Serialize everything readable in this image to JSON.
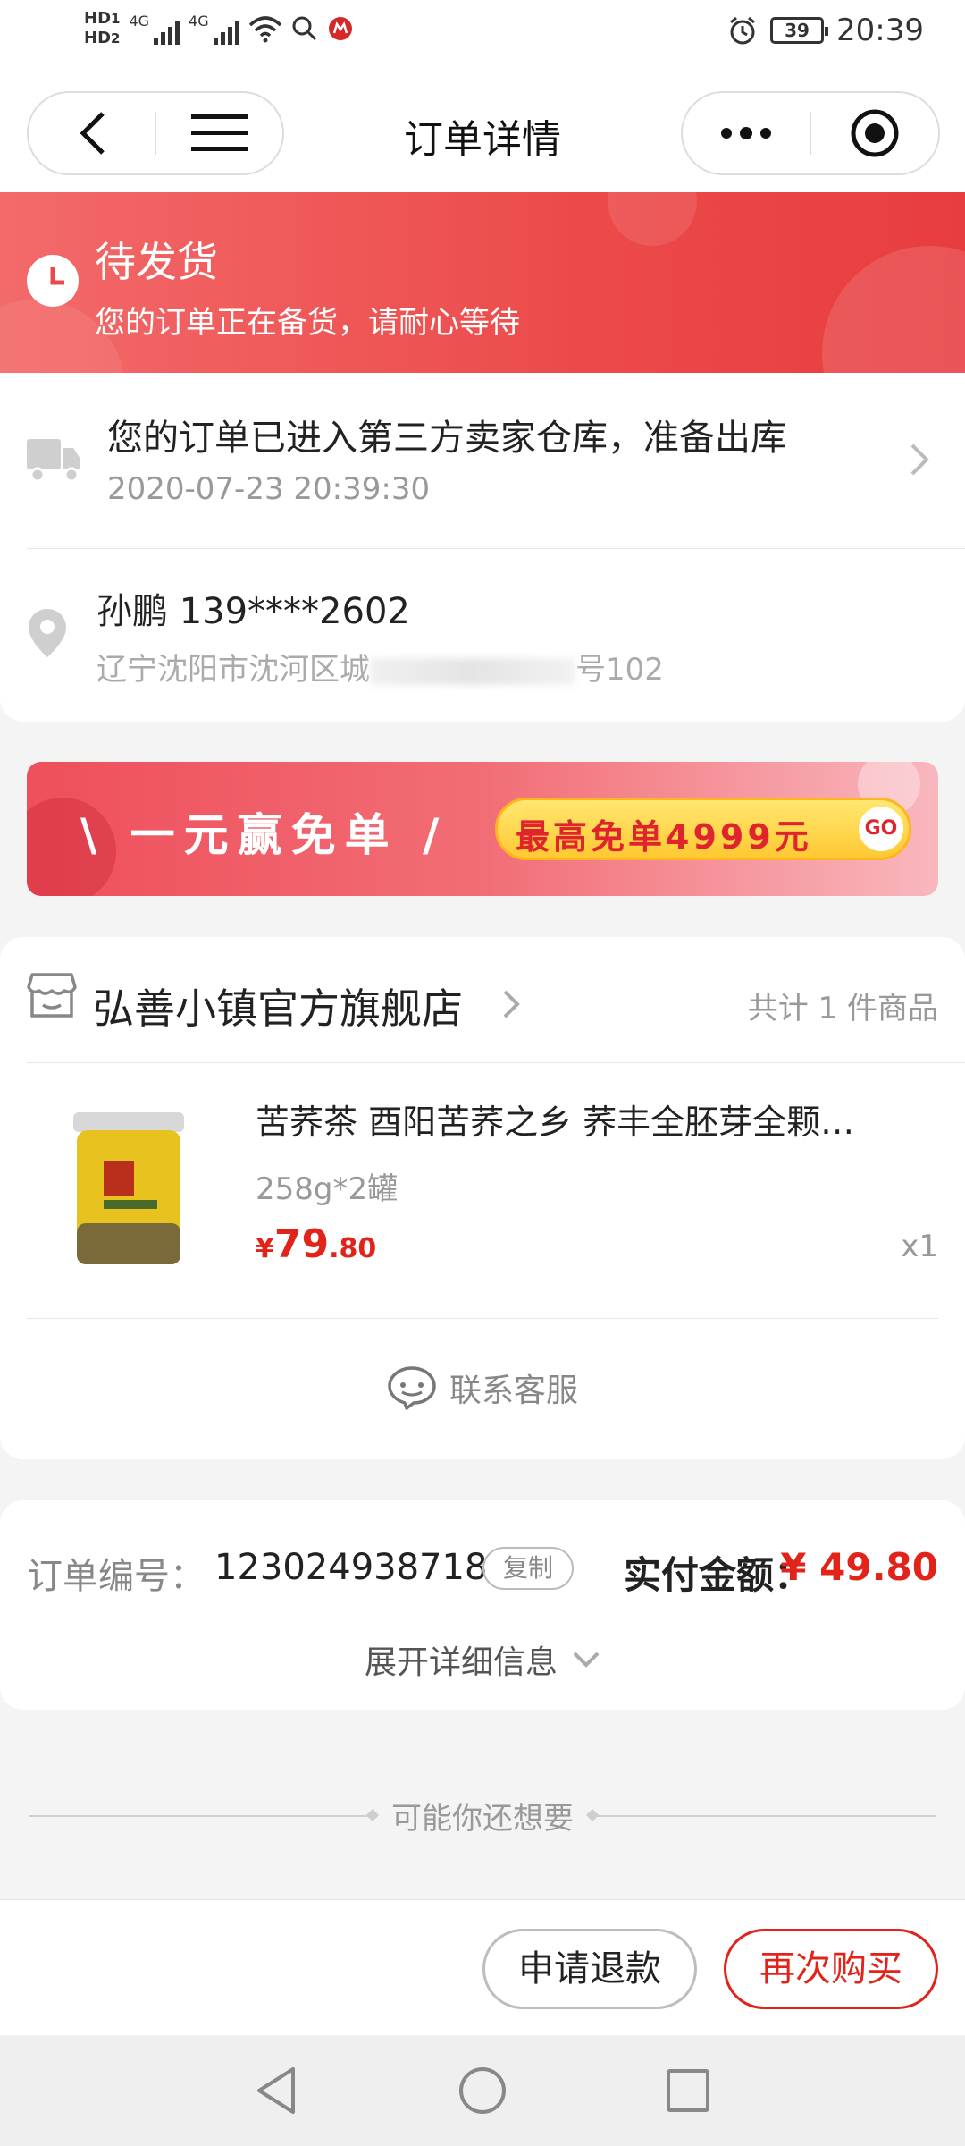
{
  "status_bar": {
    "hd1": "HD",
    "hd1_sub": "1",
    "hd2": "HD",
    "hd2_sub": "2",
    "net1": "4G",
    "net2": "4G",
    "battery": "39",
    "time": "20:39"
  },
  "nav": {
    "title": "订单详情"
  },
  "order_status": {
    "title": "待发货",
    "subtitle": "您的订单正在备货，请耐心等待"
  },
  "shipping": {
    "message": "您的订单已进入第三方卖家仓库，准备出库",
    "time": "2020-07-23 20:39:30"
  },
  "address": {
    "name_phone": "孙鹏 139****2602",
    "line_start": "辽宁沈阳市沈河区城",
    "line_end": "号102"
  },
  "promo": {
    "left_text": "\\ 一元赢免单 /",
    "pill_text": "最高免单4999元",
    "go": "GO"
  },
  "store": {
    "name": "弘善小镇官方旗舰店",
    "count": "共计 1 件商品"
  },
  "product": {
    "title": "苦荞茶 酉阳苦荞之乡 荞丰全胚芽全颗…",
    "spec": "258g*2罐",
    "price_symbol": "¥",
    "price_int": "79",
    "price_dec": ".80",
    "qty": "x1"
  },
  "customer_service": {
    "label": "联系客服"
  },
  "order": {
    "number_label": "订单编号：",
    "number": "123024938718",
    "copy": "复制",
    "paid_label": "实付金额：",
    "paid_value": "¥ 49.80",
    "expand": "展开详细信息"
  },
  "recommend": {
    "label": "可能你还想要"
  },
  "actions": {
    "refund": "申请退款",
    "rebuy": "再次购买"
  },
  "colors": {
    "accent": "#e2231a",
    "banner": "#ec4a4a"
  }
}
